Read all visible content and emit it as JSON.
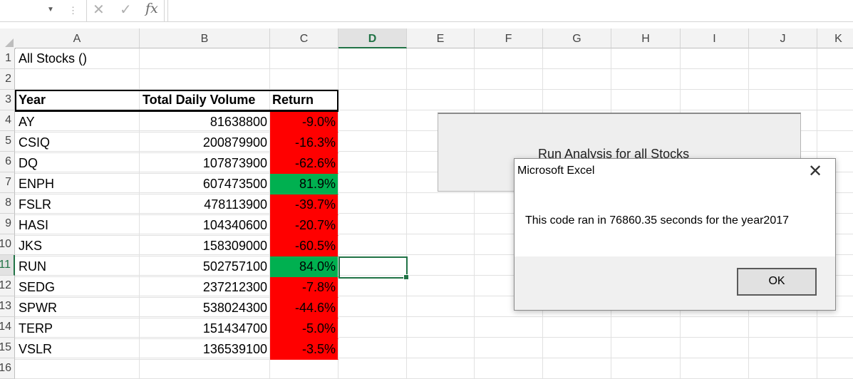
{
  "formula_bar": {
    "cancel_icon": "x-icon",
    "enter_icon": "check-icon",
    "fx_label": "fx",
    "formula": ""
  },
  "columns": [
    "A",
    "B",
    "C",
    "D",
    "E",
    "F",
    "G",
    "H",
    "I",
    "J",
    "K"
  ],
  "active_column": "D",
  "rows": [
    "1",
    "2",
    "3",
    "4",
    "5",
    "6",
    "7",
    "8",
    "9",
    "10",
    "11",
    "12",
    "13",
    "14",
    "15",
    "16"
  ],
  "active_row": "11",
  "sheet": {
    "title": "All Stocks ()",
    "headers": {
      "year": "Year",
      "volume": "Total Daily Volume",
      "return": "Return"
    },
    "data": [
      {
        "ticker": "AY",
        "volume": "81638800",
        "ret": "-9.0%",
        "status": "negative"
      },
      {
        "ticker": "CSIQ",
        "volume": "200879900",
        "ret": "-16.3%",
        "status": "negative"
      },
      {
        "ticker": "DQ",
        "volume": "107873900",
        "ret": "-62.6%",
        "status": "negative"
      },
      {
        "ticker": "ENPH",
        "volume": "607473500",
        "ret": "81.9%",
        "status": "positive"
      },
      {
        "ticker": "FSLR",
        "volume": "478113900",
        "ret": "-39.7%",
        "status": "negative"
      },
      {
        "ticker": "HASI",
        "volume": "104340600",
        "ret": "-20.7%",
        "status": "negative"
      },
      {
        "ticker": "JKS",
        "volume": "158309000",
        "ret": "-60.5%",
        "status": "negative"
      },
      {
        "ticker": "RUN",
        "volume": "502757100",
        "ret": "84.0%",
        "status": "positive"
      },
      {
        "ticker": "SEDG",
        "volume": "237212300",
        "ret": "-7.8%",
        "status": "negative"
      },
      {
        "ticker": "SPWR",
        "volume": "538024300",
        "ret": "-44.6%",
        "status": "negative"
      },
      {
        "ticker": "TERP",
        "volume": "151434700",
        "ret": "-5.0%",
        "status": "negative"
      },
      {
        "ticker": "VSLR",
        "volume": "136539100",
        "ret": "-3.5%",
        "status": "negative"
      }
    ]
  },
  "colors": {
    "negative": "#ff0000",
    "positive": "#00b050",
    "accent": "#217346"
  },
  "macro_button": {
    "label": "Run Analysis for all Stocks"
  },
  "dialog": {
    "title": "Microsoft Excel",
    "message": "This code ran in 76860.35 seconds for the year2017",
    "ok_label": "OK",
    "close_icon": "close-icon"
  }
}
